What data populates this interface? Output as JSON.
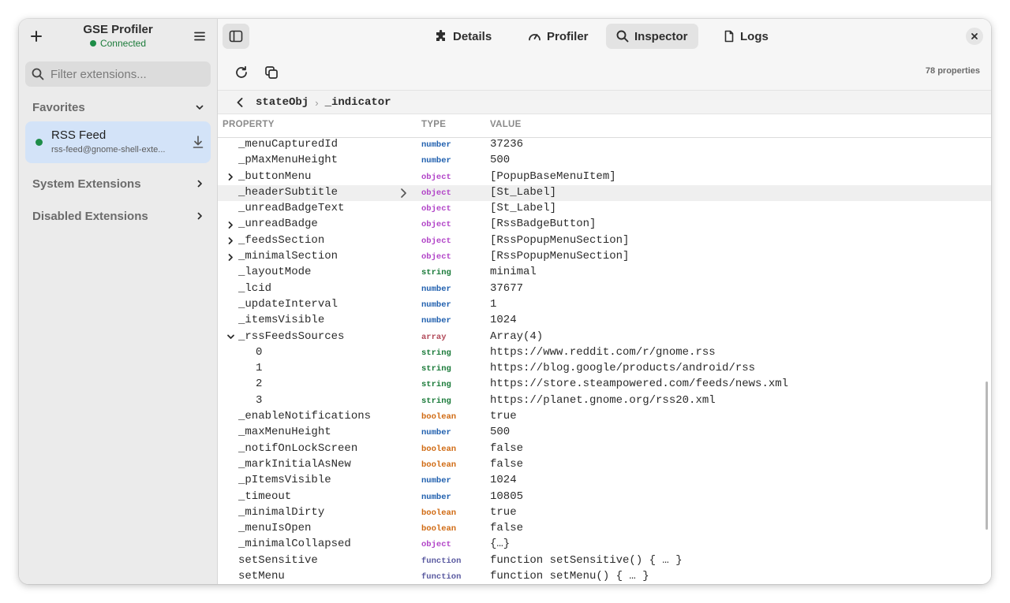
{
  "sidebar": {
    "title": "GSE Profiler",
    "status": "Connected",
    "search_placeholder": "Filter extensions...",
    "favorites_label": "Favorites",
    "extension": {
      "name": "RSS Feed",
      "id": "rss-feed@gnome-shell-exte..."
    },
    "system_label": "System Extensions",
    "disabled_label": "Disabled Extensions"
  },
  "tabs": [
    {
      "label": "Details",
      "icon": "puzzle-icon"
    },
    {
      "label": "Profiler",
      "icon": "gauge-icon"
    },
    {
      "label": "Inspector",
      "icon": "search-icon",
      "active": true
    },
    {
      "label": "Logs",
      "icon": "file-icon"
    }
  ],
  "toolbar": {
    "property_count": "78 properties"
  },
  "breadcrumb": {
    "parent": "stateObj",
    "separator": "›",
    "current": "_indicator"
  },
  "columns": {
    "property": "PROPERTY",
    "type": "TYPE",
    "value": "VALUE"
  },
  "rows": [
    {
      "prop": "_menuCapturedId",
      "type": "number",
      "value": "37236"
    },
    {
      "prop": "_pMaxMenuHeight",
      "type": "number",
      "value": "500"
    },
    {
      "prop": "_buttonMenu",
      "type": "object",
      "value": "[PopupBaseMenuItem]",
      "expander": "collapsed"
    },
    {
      "prop": "_headerSubtitle",
      "type": "object",
      "value": "[St_Label]",
      "highlight": true
    },
    {
      "prop": "_unreadBadgeText",
      "type": "object",
      "value": "[St_Label]"
    },
    {
      "prop": "_unreadBadge",
      "type": "object",
      "value": "[RssBadgeButton]",
      "expander": "collapsed"
    },
    {
      "prop": "_feedsSection",
      "type": "object",
      "value": "[RssPopupMenuSection]",
      "expander": "collapsed"
    },
    {
      "prop": "_minimalSection",
      "type": "object",
      "value": "[RssPopupMenuSection]",
      "expander": "collapsed"
    },
    {
      "prop": "_layoutMode",
      "type": "string",
      "value": "minimal"
    },
    {
      "prop": "_lcid",
      "type": "number",
      "value": "37677"
    },
    {
      "prop": "_updateInterval",
      "type": "number",
      "value": "1"
    },
    {
      "prop": "_itemsVisible",
      "type": "number",
      "value": "1024"
    },
    {
      "prop": "_rssFeedsSources",
      "type": "array",
      "value": "Array(4)",
      "expander": "expanded"
    },
    {
      "prop": "0",
      "type": "string",
      "value": "https://www.reddit.com/r/gnome.rss",
      "child": true
    },
    {
      "prop": "1",
      "type": "string",
      "value": "https://blog.google/products/android/rss",
      "child": true
    },
    {
      "prop": "2",
      "type": "string",
      "value": "https://store.steampowered.com/feeds/news.xml",
      "child": true
    },
    {
      "prop": "3",
      "type": "string",
      "value": "https://planet.gnome.org/rss20.xml",
      "child": true
    },
    {
      "prop": "_enableNotifications",
      "type": "boolean",
      "value": "true"
    },
    {
      "prop": "_maxMenuHeight",
      "type": "number",
      "value": "500"
    },
    {
      "prop": "_notifOnLockScreen",
      "type": "boolean",
      "value": "false"
    },
    {
      "prop": "_markInitialAsNew",
      "type": "boolean",
      "value": "false"
    },
    {
      "prop": "_pItemsVisible",
      "type": "number",
      "value": "1024"
    },
    {
      "prop": "_timeout",
      "type": "number",
      "value": "10805"
    },
    {
      "prop": "_minimalDirty",
      "type": "boolean",
      "value": "true"
    },
    {
      "prop": "_menuIsOpen",
      "type": "boolean",
      "value": "false"
    },
    {
      "prop": "_minimalCollapsed",
      "type": "object",
      "value": "{…}"
    },
    {
      "prop": "setSensitive",
      "type": "function",
      "value": "function setSensitive() { … }"
    },
    {
      "prop": "setMenu",
      "type": "function",
      "value": "function setMenu() { … }"
    }
  ]
}
